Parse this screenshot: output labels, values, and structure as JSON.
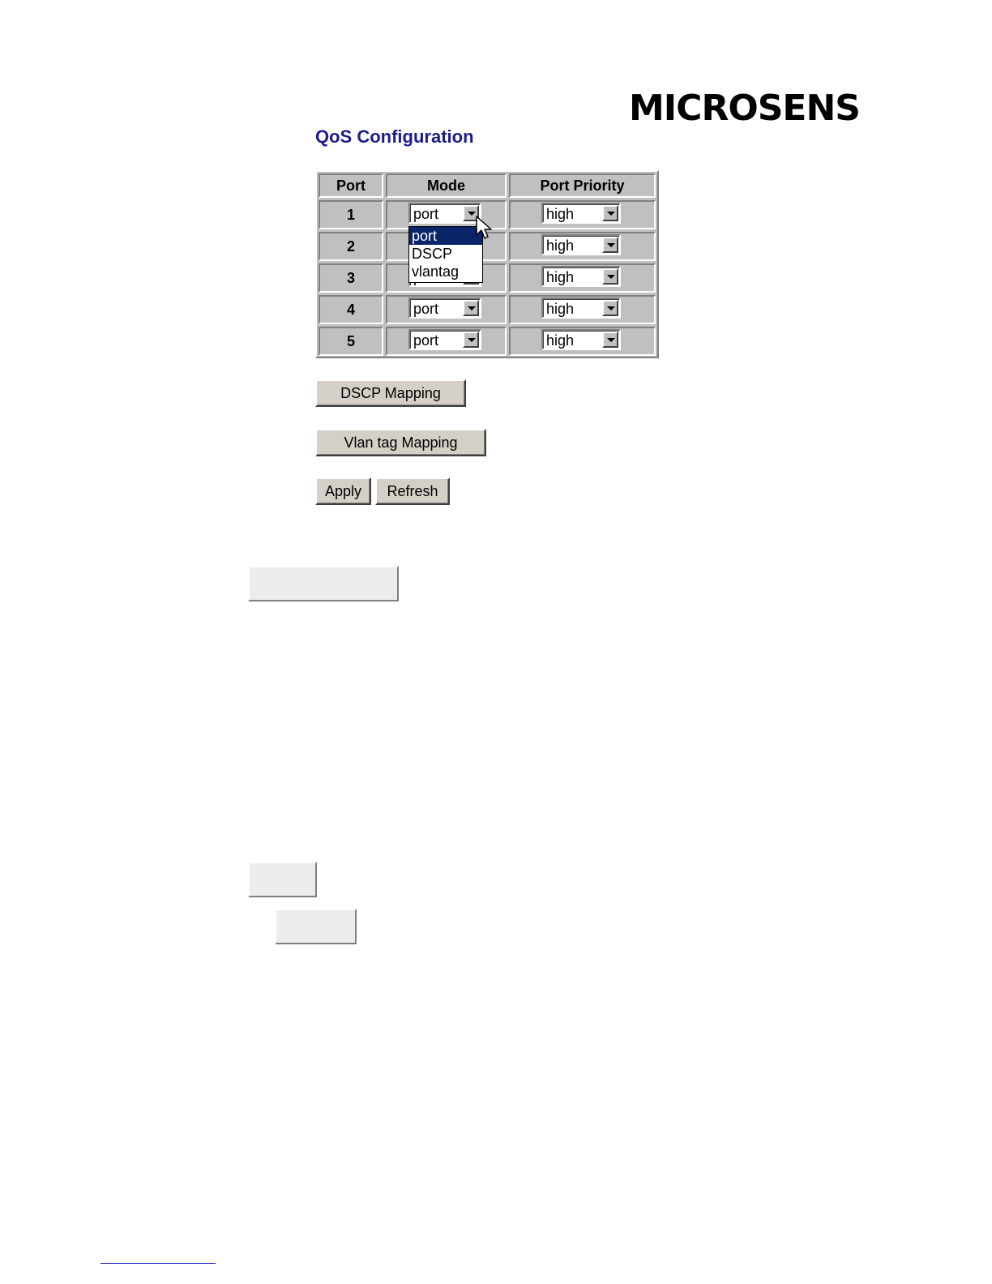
{
  "brand": {
    "logo_text": "MICROSENS"
  },
  "page": {
    "title": "QoS Configuration"
  },
  "table": {
    "headers": {
      "port": "Port",
      "mode": "Mode",
      "priority": "Port Priority"
    },
    "rows": [
      {
        "port": "1",
        "mode": "port",
        "priority": "high"
      },
      {
        "port": "2",
        "mode": "port",
        "priority": "high"
      },
      {
        "port": "3",
        "mode": "port",
        "priority": "high"
      },
      {
        "port": "4",
        "mode": "port",
        "priority": "high"
      },
      {
        "port": "5",
        "mode": "port",
        "priority": "high"
      }
    ]
  },
  "mode_dropdown": {
    "open_row": "1",
    "options": [
      "port",
      "DSCP",
      "vlantag"
    ],
    "highlighted": "port"
  },
  "buttons": {
    "dscp_mapping": "DSCP Mapping",
    "vlan_tag_mapping": "Vlan tag Mapping",
    "apply": "Apply",
    "refresh": "Refresh"
  },
  "colors": {
    "title": "#1c1c8c",
    "panel": "#c0c0c0",
    "selection": "#0a246a"
  }
}
